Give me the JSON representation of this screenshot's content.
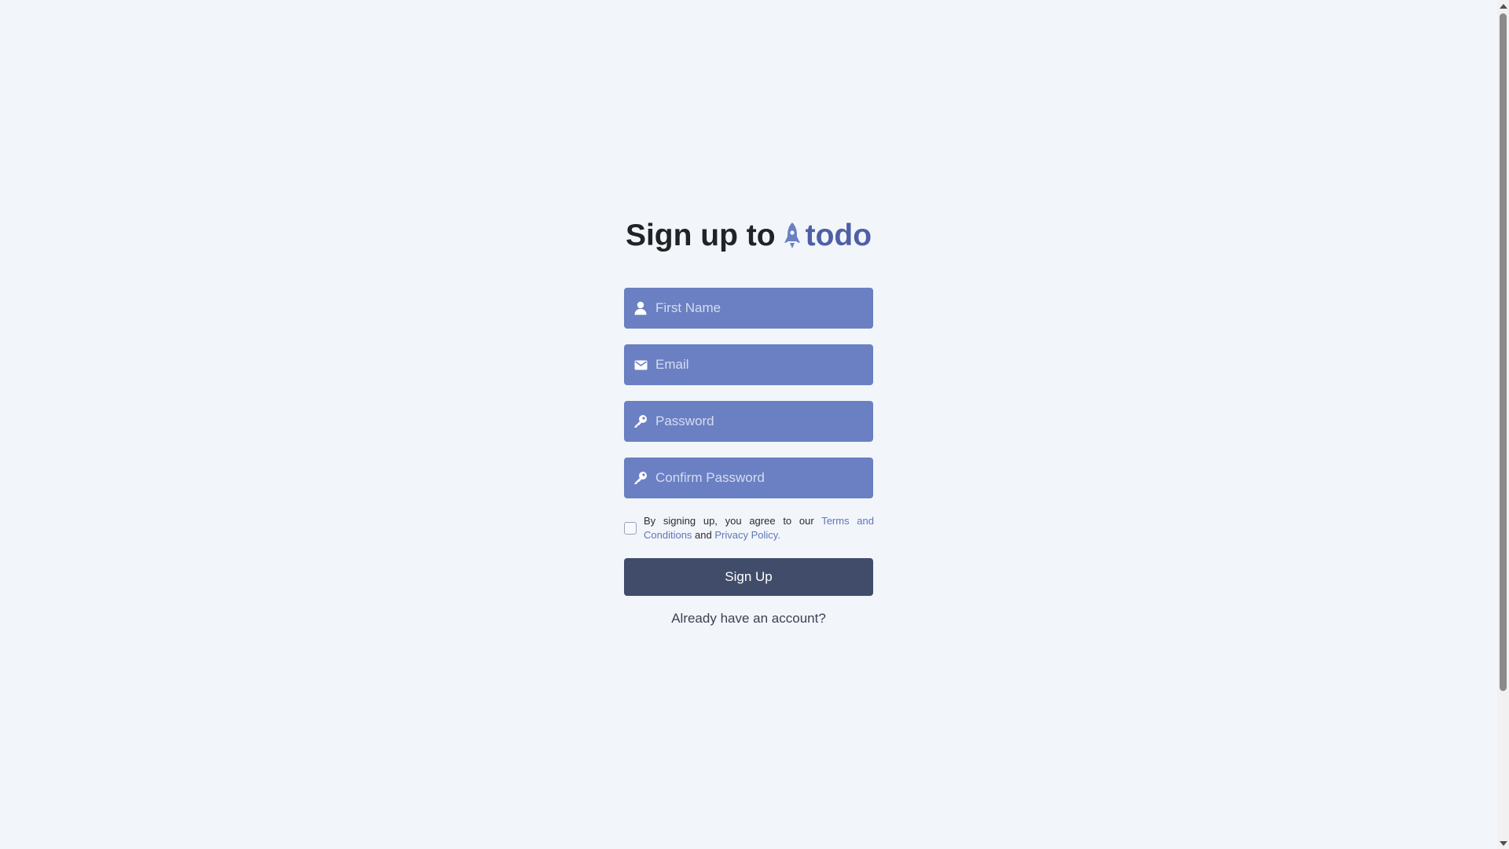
{
  "title": {
    "prefix": "Sign up to",
    "brand_name": "todo",
    "brand_icon": "rocket-icon"
  },
  "form": {
    "first_name": {
      "placeholder": "First Name",
      "value": "",
      "icon": "user-icon"
    },
    "email": {
      "placeholder": "Email",
      "value": "",
      "icon": "mail-icon"
    },
    "password": {
      "placeholder": "Password",
      "value": "",
      "icon": "key-icon"
    },
    "confirm_password": {
      "placeholder": "Confirm Password",
      "value": "",
      "icon": "key-icon"
    }
  },
  "terms": {
    "checked": false,
    "text_before": "By signing up, you agree to our ",
    "terms_link": "Terms and Conditions",
    "text_middle": " and ",
    "privacy_link": "Privacy Policy",
    "text_after": "."
  },
  "actions": {
    "signup_label": "Sign Up",
    "login_link": "Already have an account?"
  },
  "colors": {
    "background": "#f2f6fb",
    "field": "#6b80c2",
    "button": "#414c6a",
    "brand": "#4e5fa6",
    "link": "#5f75b8"
  }
}
